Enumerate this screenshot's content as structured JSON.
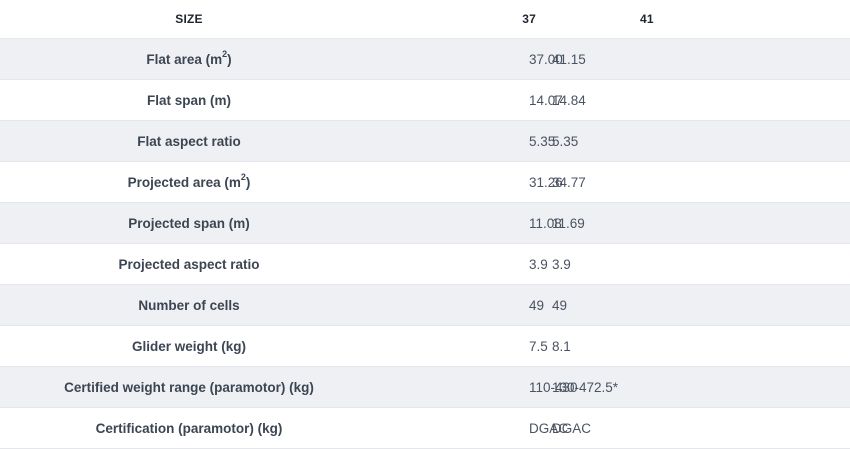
{
  "table": {
    "header": {
      "label": "SIZE",
      "size_a": "37",
      "size_b": "41"
    },
    "rows": [
      {
        "label": "Flat area (m",
        "sup": "2",
        "label_end": ")",
        "a": "37.00",
        "b": "41.15"
      },
      {
        "label": "Flat span (m)",
        "a": "14.07",
        "b": "14.84"
      },
      {
        "label": "Flat aspect ratio",
        "a": "5.35",
        "b": "5.35"
      },
      {
        "label": "Projected area (m",
        "sup": "2",
        "label_end": ")",
        "a": "31.26",
        "b": "34.77"
      },
      {
        "label": "Projected span (m)",
        "a": "11.08",
        "b": "11.69"
      },
      {
        "label": "Projected aspect ratio",
        "a": "3.9",
        "b": "3.9"
      },
      {
        "label": "Number of cells",
        "a": "49",
        "b": "49"
      },
      {
        "label": "Glider weight (kg)",
        "a": "7.5",
        "b": "8.1"
      },
      {
        "label": "Certified weight range (paramotor) (kg)",
        "a": "110-430",
        "b": "130-472.5*"
      },
      {
        "label": "Certification (paramotor) (kg)",
        "a": "DGAC",
        "b": "DGAC"
      }
    ]
  },
  "colors": {
    "stripe": "#eef0f3",
    "text": "#3c4653",
    "header_text": "#1f2630"
  }
}
